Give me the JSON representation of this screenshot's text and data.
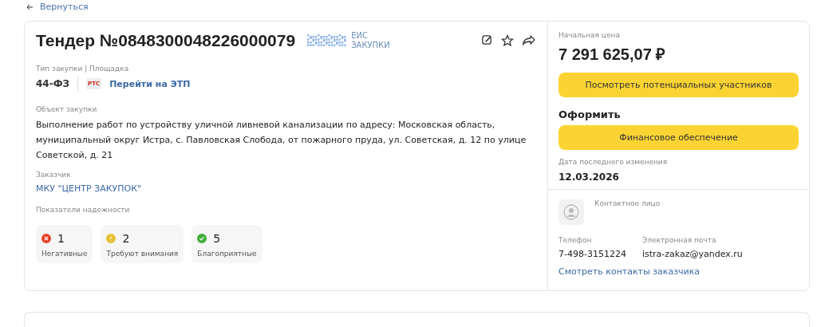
{
  "back_link": "Вернуться",
  "tender": {
    "title": "Тендер №0848300048226000079",
    "logo": {
      "line_1": "ЕИС",
      "line_2": "ЗАКУПКИ"
    },
    "type_label": "Тип закупки | Площадка",
    "law": "44-ФЗ",
    "platform_badge": "РТС",
    "platform_link": "Перейти на ЭТП",
    "object_label": "Объект закупки",
    "object_text": "Выполнение работ по устройству уличной ливневой канализации по адресу: Московская область, муниципальный округ Истра, с. Павловская Слобода, от пожарного пруда, ул. Советская, д. 12 по улице Советской, д. 21",
    "customer_label": "Заказчик",
    "customer": "МКУ \"ЦЕНТР ЗАКУПОК\"",
    "reliability_label": "Показатели надежности",
    "indicators": [
      {
        "kind": "negative",
        "color": "#e8452c",
        "count": "1",
        "label": "Негативные"
      },
      {
        "kind": "warning",
        "color": "#e6c234",
        "count": "2",
        "label": "Требуют внимания"
      },
      {
        "kind": "positive",
        "color": "#3fae3a",
        "count": "5",
        "label": "Благоприятные"
      }
    ]
  },
  "sidebar": {
    "price_label": "Начальная цена",
    "price": "7 291 625,07 ₽",
    "participants_button": "Посмотреть потенциальных участников",
    "apply_heading": "Оформить",
    "finance_button": "Финансовое обеспечение",
    "date_label": "Дата последнего изменения",
    "date": "12.03.2026",
    "contact_label": "Контактное лицо",
    "phone_label": "Телефон",
    "phone": "7-498-3151224",
    "email_label": "Электронная почта",
    "email": "istra-zakaz@yandex.ru",
    "contacts_link": "Смотреть контакты заказчика"
  }
}
